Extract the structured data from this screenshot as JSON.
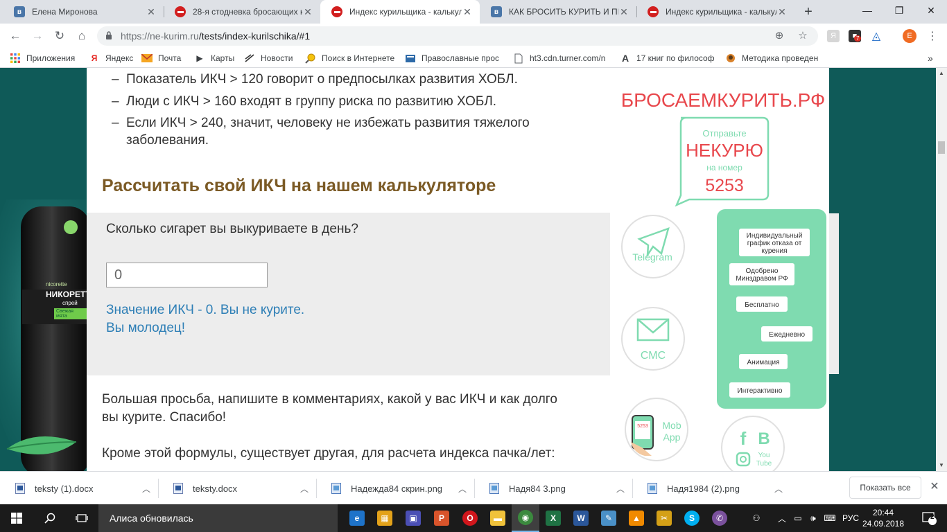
{
  "browser": {
    "tabs": [
      {
        "title": "Елена Миронова",
        "favicon": "vk"
      },
      {
        "title": "28-я стодневка бросающих к",
        "favicon": "red"
      },
      {
        "title": "Индекс курильщика - калькул",
        "favicon": "red",
        "active": true
      },
      {
        "title": "КАК БРОСИТЬ КУРИТЬ И ПИТ",
        "favicon": "vk"
      },
      {
        "title": "Индекс курильщика - калькул",
        "favicon": "red"
      }
    ],
    "url_host": "https://ne-kurim.ru",
    "url_path": "/tests/index-kurilschika/#1",
    "profile_initial": "E",
    "extension_badge": "7",
    "bookmarks": [
      {
        "label": "Приложения",
        "icon": "apps-grid-icon"
      },
      {
        "label": "Яндекс",
        "icon": "yandex-icon"
      },
      {
        "label": "Почта",
        "icon": "mail-icon"
      },
      {
        "label": "Карты",
        "icon": "maps-icon"
      },
      {
        "label": "Новости",
        "icon": "news-icon"
      },
      {
        "label": "Поиск в Интернете",
        "icon": "search-web-icon"
      },
      {
        "label": "Православные прос",
        "icon": "orthodox-icon"
      },
      {
        "label": "ht3.cdn.turner.com/n",
        "icon": "page-icon"
      },
      {
        "label": "17 книг по философ",
        "icon": "a-letter-icon"
      },
      {
        "label": "Методика проведен",
        "icon": "method-icon"
      }
    ],
    "bookmarks_more": "»"
  },
  "page": {
    "bullets": [
      {
        "dash": "–",
        "lines": [
          "Показатель ИКЧ > 120 говорит о предпосылках развития ХОБЛ."
        ]
      },
      {
        "dash": "–",
        "lines": [
          "Люди с ИКЧ > 160 входят в группу риска по развитию ХОБЛ."
        ]
      },
      {
        "dash": "–",
        "lines": [
          "Если ИКЧ > 240, значит, человеку не избежать развития тяжелого",
          "заболевания."
        ]
      }
    ],
    "calc_heading": "Рассчитать свой ИКЧ на нашем калькуляторе",
    "calc": {
      "question": "Сколько сигарет вы выкуриваете в день?",
      "input_value": "0",
      "result_line1": "Значение ИКЧ - 0. Вы не курите.",
      "result_line2": "Вы молодец!"
    },
    "para1_line1": "Большая просьба, напишите в комментариях, какой у вас ИКЧ и как долго",
    "para1_line2": "вы курите. Спасибо!",
    "para2": "Кроме этой формулы, существует другая, для расчета индекса пачка/лет:"
  },
  "ad_left": {
    "brand": "НИКОРЕТТ",
    "sub": "спрей",
    "small": "nicorette",
    "flavor": "Свежая мята"
  },
  "ad_right": {
    "site": "БРОСАЕМКУРИТЬ.РФ",
    "send": "Отправьте",
    "word": "НЕКУРЮ",
    "to_number": "на номер",
    "number": "5253",
    "telegram": "Telegram",
    "sms": "СМС",
    "mob1": "Mob",
    "mob2": "App",
    "phone_screen": "5253",
    "chat_bubbles": [
      [
        "Индивидуальный",
        "график отказа от",
        "курения"
      ],
      [
        "Одобрено",
        "Минздравом РФ"
      ],
      [
        "Бесплатно"
      ],
      [
        "Ежедневно"
      ],
      [
        "Анимация"
      ],
      [
        "Интерактивно"
      ]
    ],
    "social_f": "f",
    "social_b": "B",
    "social_you": "You",
    "social_tube": "Tube",
    "brand_green": "#7fdbb0",
    "brand_red": "#e8474c"
  },
  "downloads": {
    "items": [
      {
        "name": "teksty (1).docx",
        "type": "docx"
      },
      {
        "name": "teksty.docx",
        "type": "docx"
      },
      {
        "name": "Надежда84 скрин.png",
        "type": "png"
      },
      {
        "name": "Надя84 3.png",
        "type": "png"
      },
      {
        "name": "Надя1984 (2).png",
        "type": "png"
      }
    ],
    "show_all": "Показать все"
  },
  "taskbar": {
    "cortana_text": "Алиса обновилась",
    "lang": "РУС",
    "time": "20:44",
    "date": "24.09.2018",
    "notif_count": "2",
    "apps": [
      {
        "icon": "edge-icon",
        "glyph": "e",
        "color": "#1e73c9"
      },
      {
        "icon": "store-icon",
        "glyph": "▦",
        "color": "#e3a21a"
      },
      {
        "icon": "save-app-icon",
        "glyph": "▣",
        "color": "#4b4fb5"
      },
      {
        "icon": "slides-app-icon",
        "glyph": "P",
        "color": "#d9542b"
      },
      {
        "icon": "opera-icon",
        "glyph": "O",
        "color": "#d1161c"
      },
      {
        "icon": "explorer-icon",
        "glyph": "▬",
        "color": "#f0c23b"
      },
      {
        "icon": "chrome-icon",
        "glyph": "◉",
        "color": "#3b8a3e"
      },
      {
        "icon": "excel-icon",
        "glyph": "X",
        "color": "#1f7244"
      },
      {
        "icon": "word-icon",
        "glyph": "W",
        "color": "#2b579a"
      },
      {
        "icon": "paint-icon",
        "glyph": "✎",
        "color": "#4a90c7"
      },
      {
        "icon": "vlc-icon",
        "glyph": "▲",
        "color": "#f08a00"
      },
      {
        "icon": "tool-icon",
        "glyph": "✂",
        "color": "#d4a017"
      },
      {
        "icon": "skype-icon",
        "glyph": "S",
        "color": "#00aff0"
      },
      {
        "icon": "viber-icon",
        "glyph": "✆",
        "color": "#7b519d"
      }
    ]
  }
}
